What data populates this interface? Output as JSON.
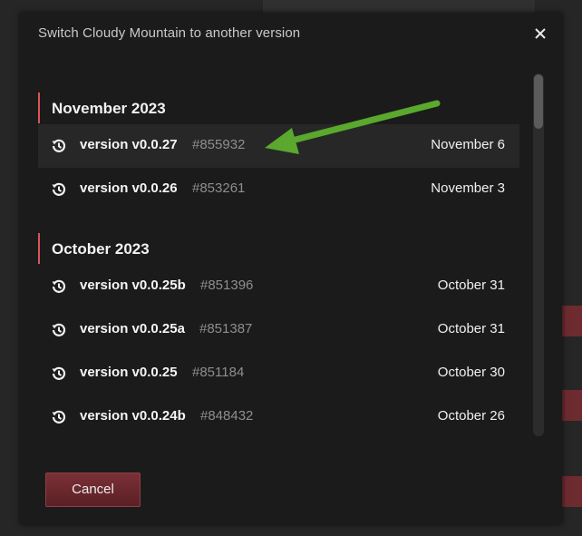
{
  "dialog": {
    "title": "Switch Cloudy Mountain to another version",
    "close_icon": "close-icon",
    "cancel_label": "Cancel"
  },
  "groups": [
    {
      "month": "November 2023",
      "versions": [
        {
          "name": "version v0.0.27",
          "hash": "#855932",
          "date": "November 6",
          "highlighted": true
        },
        {
          "name": "version v0.0.26",
          "hash": "#853261",
          "date": "November 3",
          "highlighted": false
        }
      ]
    },
    {
      "month": "October 2023",
      "versions": [
        {
          "name": "version v0.0.25b",
          "hash": "#851396",
          "date": "October 31",
          "highlighted": false
        },
        {
          "name": "version v0.0.25a",
          "hash": "#851387",
          "date": "October 31",
          "highlighted": false
        },
        {
          "name": "version v0.0.25",
          "hash": "#851184",
          "date": "October 30",
          "highlighted": false
        },
        {
          "name": "version v0.0.24b",
          "hash": "#848432",
          "date": "October 26",
          "highlighted": false
        }
      ]
    }
  ],
  "icons": {
    "version": "history-icon"
  },
  "colors": {
    "accent_red": "#d9545a",
    "cancel_button": "#6e2b2f",
    "annotation_arrow": "#5aa82d"
  }
}
